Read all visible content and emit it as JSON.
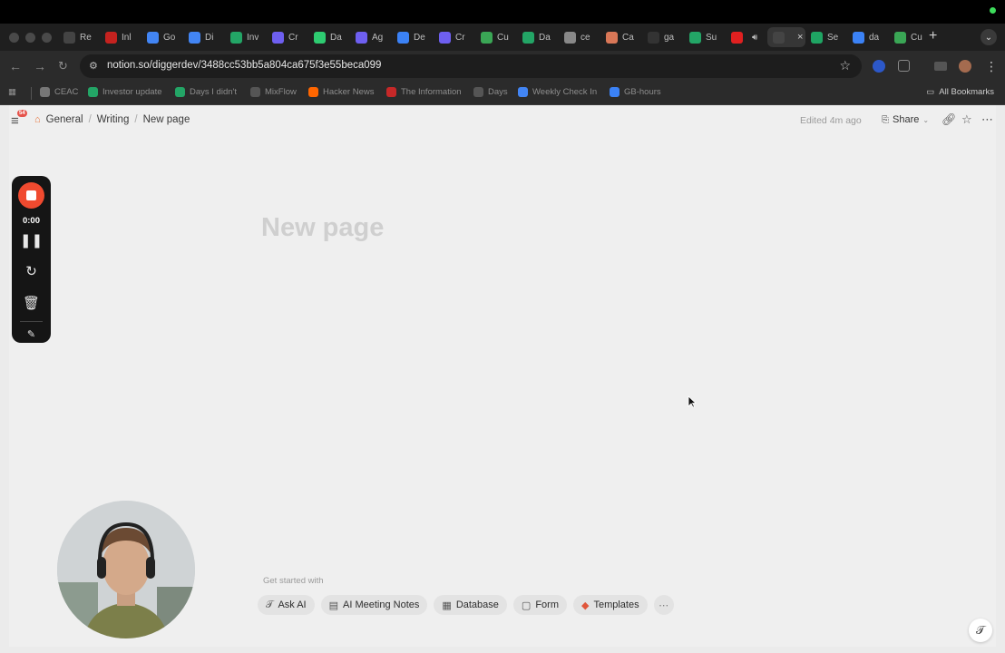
{
  "colors": {
    "accent": "#f04a2f",
    "page_bg": "#efefef",
    "title_placeholder": "#cfcfcf"
  },
  "browser": {
    "tabs": [
      {
        "label": "Re",
        "icon": "notion-icon",
        "color": "#444"
      },
      {
        "label": "Inl",
        "icon": "gmail-icon",
        "color": "#c5221f"
      },
      {
        "label": "Go",
        "icon": "google-docs-icon",
        "color": "#4285f4"
      },
      {
        "label": "Di",
        "icon": "google-docs-icon",
        "color": "#4285f4"
      },
      {
        "label": "Inv",
        "icon": "google-sheets-icon",
        "color": "#23a566"
      },
      {
        "label": "Cr",
        "icon": "linear-icon",
        "color": "#6e5ff0"
      },
      {
        "label": "Da",
        "icon": "app-icon",
        "color": "#2ecc71"
      },
      {
        "label": "Ag",
        "icon": "linear-icon",
        "color": "#6e5ff0"
      },
      {
        "label": "De",
        "icon": "ai-icon",
        "color": "#3b82f6"
      },
      {
        "label": "Cr",
        "icon": "linear-icon",
        "color": "#6e5ff0"
      },
      {
        "label": "Cu",
        "icon": "cursor-app-icon",
        "color": "#3aa655"
      },
      {
        "label": "Da",
        "icon": "google-sheets-icon",
        "color": "#23a566"
      },
      {
        "label": "ce",
        "icon": "globe-icon",
        "color": "#888"
      },
      {
        "label": "Ca",
        "icon": "claude-icon",
        "color": "#d97757"
      },
      {
        "label": "ga",
        "icon": "github-icon",
        "color": "#333"
      },
      {
        "label": "Su",
        "icon": "sheets-icon",
        "color": "#23a566"
      },
      {
        "label": "",
        "icon": "youtube-icon",
        "color": "#e02020"
      },
      {
        "label": "",
        "icon": "notion-icon",
        "color": "#444"
      },
      {
        "label": "Se",
        "icon": "drive-icon",
        "color": "#1fa463"
      },
      {
        "label": "da",
        "icon": "ai-icon",
        "color": "#3b82f6"
      },
      {
        "label": "Cu",
        "icon": "cursor-app-icon",
        "color": "#3aa655"
      }
    ],
    "url": "notion.so/diggerdev/3488cc53bb5a804ca675f3e55beca099",
    "bookmarks": [
      {
        "label": "CEAC",
        "icon": "globe-icon",
        "color": "#777"
      },
      {
        "label": "Investor update",
        "icon": "google-sheets-icon",
        "color": "#23a566"
      },
      {
        "label": "Days I didn't",
        "icon": "google-sheets-icon",
        "color": "#23a566"
      },
      {
        "label": "MixFlow",
        "icon": "notion-icon",
        "color": "#555"
      },
      {
        "label": "Hacker News",
        "icon": "hacker-news-icon",
        "color": "#ff6600"
      },
      {
        "label": "The Information",
        "icon": "information-icon",
        "color": "#c62828"
      },
      {
        "label": "Days",
        "icon": "notion-icon",
        "color": "#555"
      },
      {
        "label": "Weekly Check In",
        "icon": "google-docs-icon",
        "color": "#4285f4"
      },
      {
        "label": "GB-hours",
        "icon": "ai-icon",
        "color": "#3b82f6"
      }
    ],
    "all_bookmarks": "All Bookmarks"
  },
  "notion": {
    "notification_count": "54",
    "breadcrumb": [
      "General",
      "Writing",
      "New page"
    ],
    "edited": "Edited 4m ago",
    "share_label": "Share",
    "title_placeholder": "New page",
    "get_started": "Get started with",
    "chips": [
      {
        "label": "Ask AI",
        "icon": "notion-ai-icon",
        "glyph": "𝒯"
      },
      {
        "label": "AI Meeting Notes",
        "icon": "meeting-notes-icon",
        "glyph": "▤"
      },
      {
        "label": "Database",
        "icon": "table-icon",
        "glyph": "▦"
      },
      {
        "label": "Form",
        "icon": "form-icon",
        "glyph": "▢"
      },
      {
        "label": "Templates",
        "icon": "templates-icon",
        "glyph": "◆"
      }
    ]
  },
  "recorder": {
    "time": "0:00"
  }
}
